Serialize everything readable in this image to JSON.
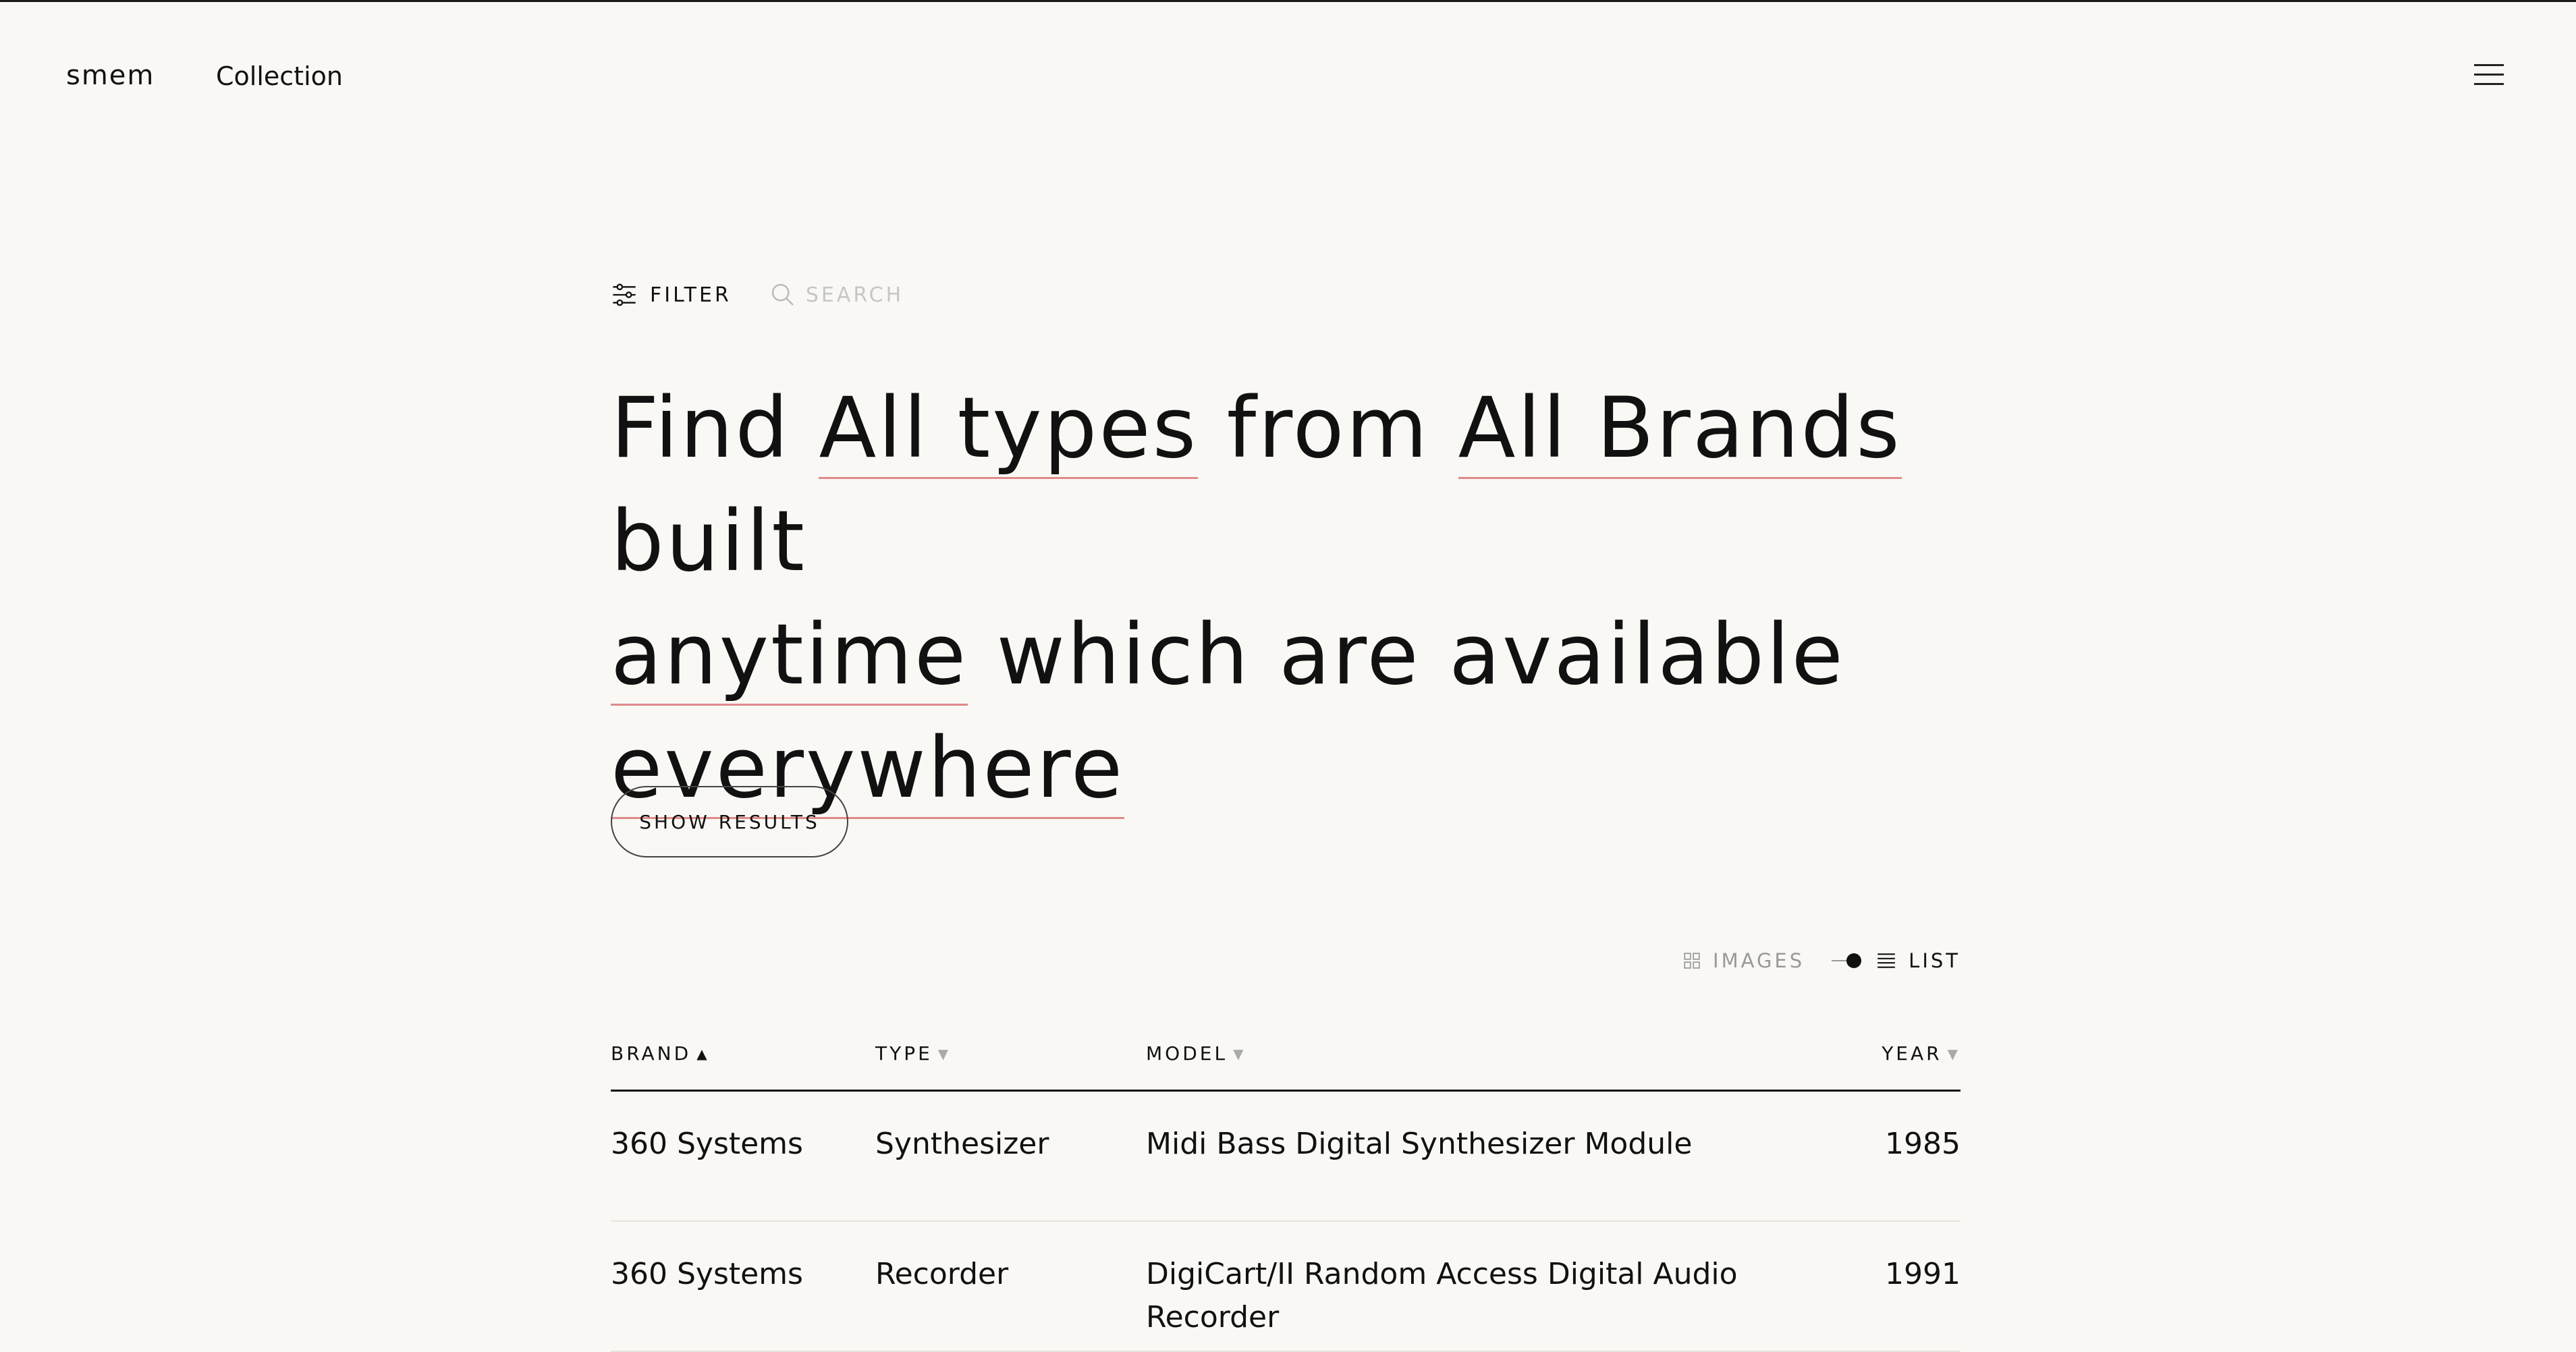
{
  "header": {
    "logo": "smem",
    "nav_collection": "Collection"
  },
  "toolbar": {
    "filter_label": "FILTER",
    "search_placeholder": "SEARCH"
  },
  "headline": {
    "word_find": "Find",
    "filter_type": "All types",
    "word_from": "from",
    "filter_brand": "All Brands",
    "word_built": "built",
    "filter_year": "anytime",
    "word_which": "which are available",
    "filter_availability": "everywhere"
  },
  "show_results_label": "SHOW RESULTS",
  "view_toggle": {
    "images_label": "IMAGES",
    "list_label": "LIST",
    "active": "list"
  },
  "table": {
    "columns": {
      "brand": "BRAND",
      "type": "TYPE",
      "model": "MODEL",
      "year": "YEAR"
    },
    "sort": {
      "column": "brand",
      "direction": "ascending"
    },
    "rows": [
      {
        "brand": "360 Systems",
        "type": "Synthesizer",
        "model": "Midi Bass Digital Synthesizer Module",
        "year": "1985"
      },
      {
        "brand": "360 Systems",
        "type": "Recorder",
        "model": "DigiCart/II Random Access Digital Audio Recorder",
        "year": "1991"
      }
    ]
  },
  "colors": {
    "background": "#f9f8f5",
    "text": "#111111",
    "filter_underline": "#e08a8a",
    "muted": "#999999"
  }
}
